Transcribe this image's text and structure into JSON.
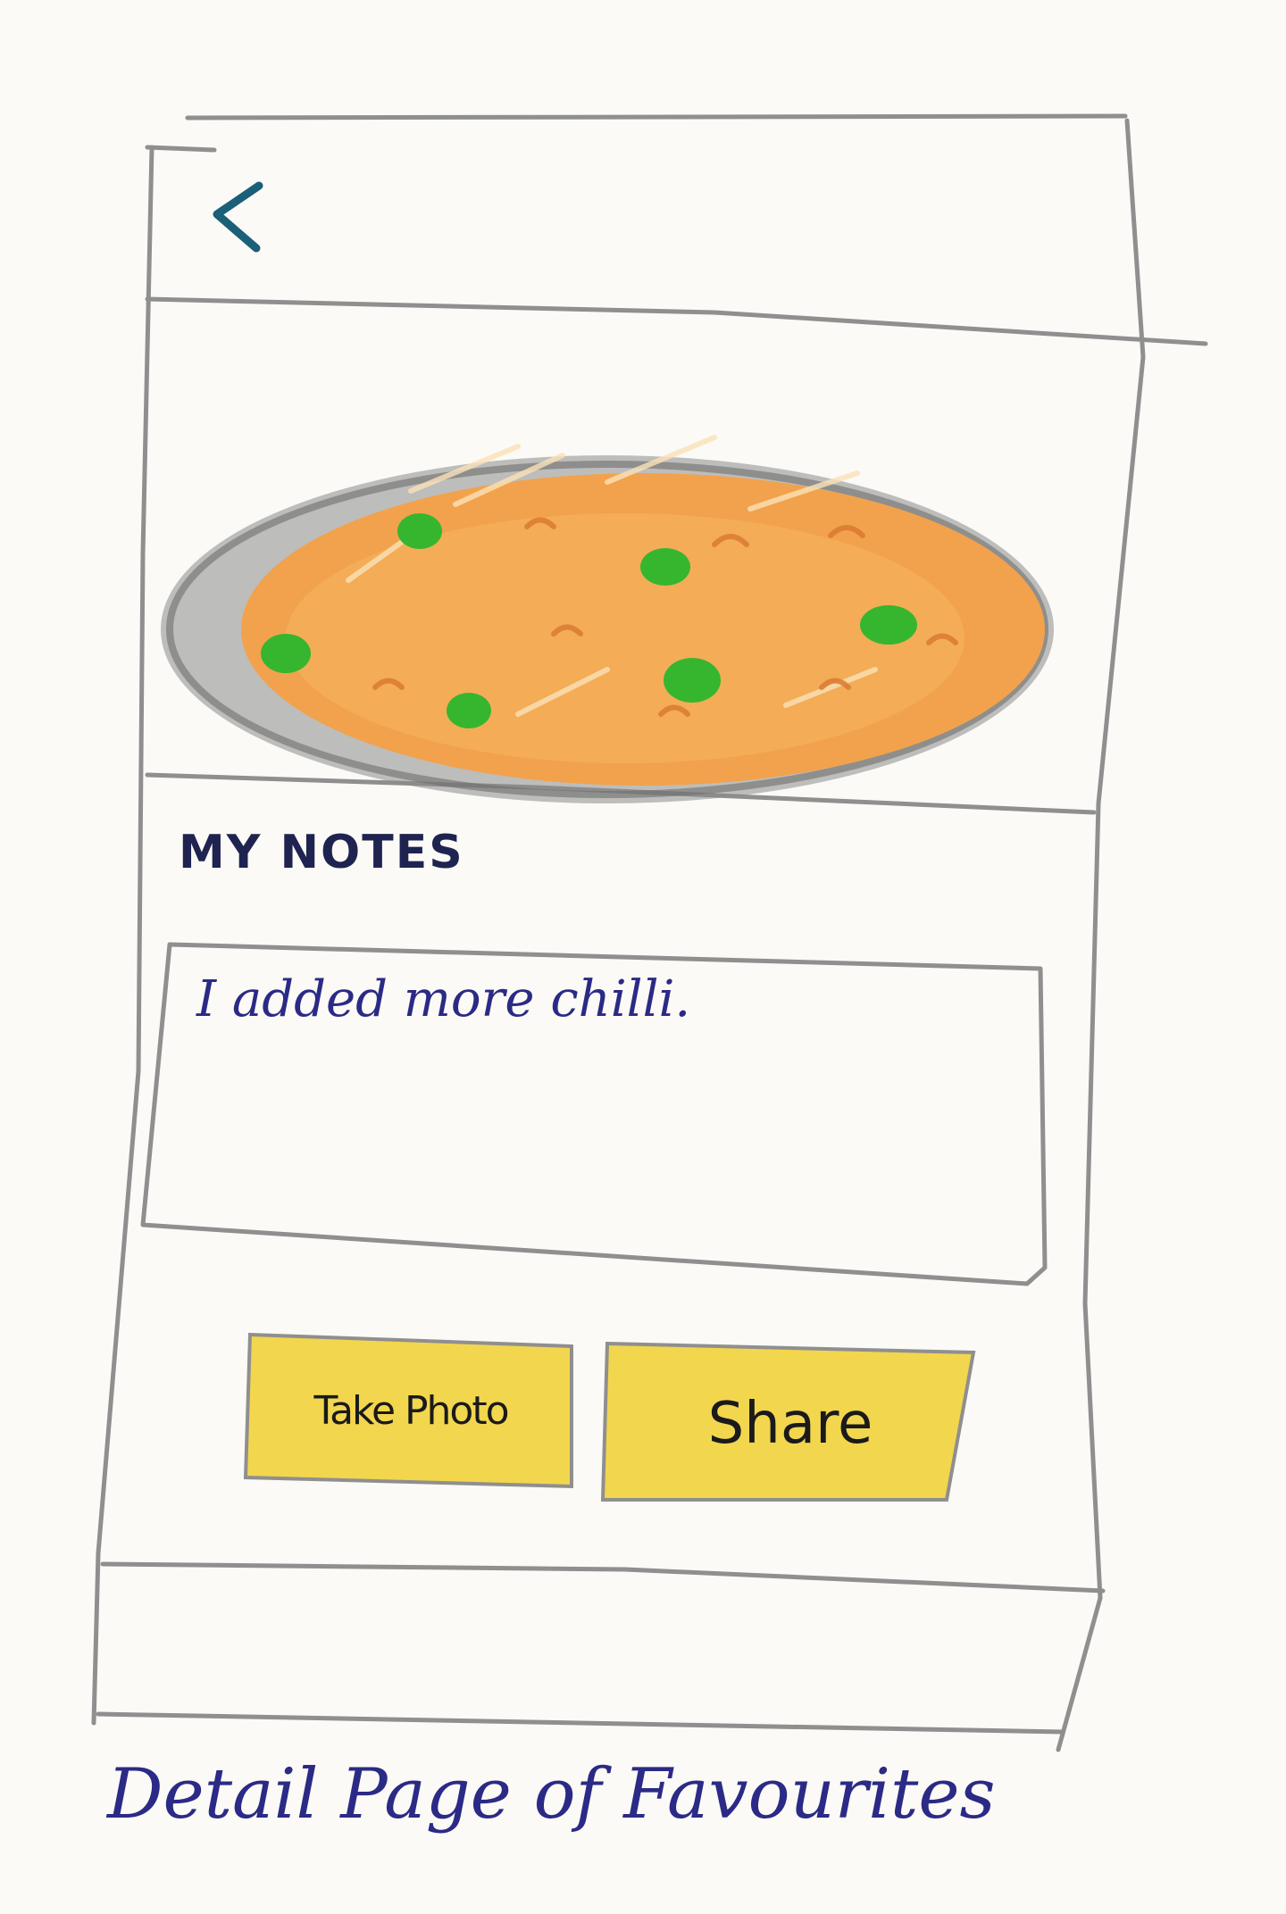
{
  "header": {
    "back_icon": "chevron-left-icon"
  },
  "content": {
    "image_icon": "food-dish-image",
    "notes_title": "MY NOTES",
    "notes_value": "I added more chilli."
  },
  "actions": {
    "take_photo_label": "Take Photo",
    "share_label": "Share"
  },
  "caption": "Detail Page of Favourites",
  "colors": {
    "pencil": "#8e8e8e",
    "accent_teal": "#1b5f78",
    "button_yellow": "#f2d64e",
    "ink_blue": "#2b2a86",
    "sauce_orange": "#f2a24c",
    "pea_green": "#35b62e"
  }
}
